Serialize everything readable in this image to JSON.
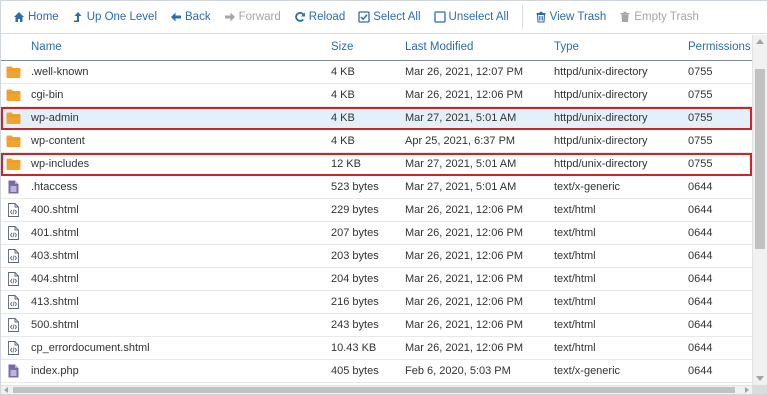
{
  "toolbar": {
    "home": "Home",
    "up_one_level": "Up One Level",
    "back": "Back",
    "forward": "Forward",
    "reload": "Reload",
    "select_all": "Select All",
    "unselect_all": "Unselect All",
    "view_trash": "View Trash",
    "empty_trash": "Empty Trash"
  },
  "columns": {
    "name": "Name",
    "size": "Size",
    "last_modified": "Last Modified",
    "type": "Type",
    "permissions": "Permissions"
  },
  "colors": {
    "link_blue": "#2a6db0",
    "folder": "#f0a430",
    "file_purple": "#7a6aa8",
    "highlight_red": "#c9262b",
    "selected_row": "#e4f0f9"
  },
  "files": [
    {
      "icon": "folder-icon",
      "name": ".well-known",
      "size": "4 KB",
      "modified": "Mar 26, 2021, 12:07 PM",
      "type": "httpd/unix-directory",
      "perms": "0755",
      "selected": false,
      "highlight": false
    },
    {
      "icon": "folder-icon",
      "name": "cgi-bin",
      "size": "4 KB",
      "modified": "Mar 26, 2021, 12:06 PM",
      "type": "httpd/unix-directory",
      "perms": "0755",
      "selected": false,
      "highlight": false
    },
    {
      "icon": "folder-icon",
      "name": "wp-admin",
      "size": "4 KB",
      "modified": "Mar 27, 2021, 5:01 AM",
      "type": "httpd/unix-directory",
      "perms": "0755",
      "selected": true,
      "highlight": true
    },
    {
      "icon": "folder-icon",
      "name": "wp-content",
      "size": "4 KB",
      "modified": "Apr 25, 2021, 6:37 PM",
      "type": "httpd/unix-directory",
      "perms": "0755",
      "selected": false,
      "highlight": false
    },
    {
      "icon": "folder-icon",
      "name": "wp-includes",
      "size": "12 KB",
      "modified": "Mar 27, 2021, 5:01 AM",
      "type": "httpd/unix-directory",
      "perms": "0755",
      "selected": false,
      "highlight": true
    },
    {
      "icon": "text-file-icon",
      "name": ".htaccess",
      "size": "523 bytes",
      "modified": "Mar 27, 2021, 5:01 AM",
      "type": "text/x-generic",
      "perms": "0644",
      "selected": false,
      "highlight": false
    },
    {
      "icon": "code-file-icon",
      "name": "400.shtml",
      "size": "229 bytes",
      "modified": "Mar 26, 2021, 12:06 PM",
      "type": "text/html",
      "perms": "0644",
      "selected": false,
      "highlight": false
    },
    {
      "icon": "code-file-icon",
      "name": "401.shtml",
      "size": "207 bytes",
      "modified": "Mar 26, 2021, 12:06 PM",
      "type": "text/html",
      "perms": "0644",
      "selected": false,
      "highlight": false
    },
    {
      "icon": "code-file-icon",
      "name": "403.shtml",
      "size": "203 bytes",
      "modified": "Mar 26, 2021, 12:06 PM",
      "type": "text/html",
      "perms": "0644",
      "selected": false,
      "highlight": false
    },
    {
      "icon": "code-file-icon",
      "name": "404.shtml",
      "size": "204 bytes",
      "modified": "Mar 26, 2021, 12:06 PM",
      "type": "text/html",
      "perms": "0644",
      "selected": false,
      "highlight": false
    },
    {
      "icon": "code-file-icon",
      "name": "413.shtml",
      "size": "216 bytes",
      "modified": "Mar 26, 2021, 12:06 PM",
      "type": "text/html",
      "perms": "0644",
      "selected": false,
      "highlight": false
    },
    {
      "icon": "code-file-icon",
      "name": "500.shtml",
      "size": "243 bytes",
      "modified": "Mar 26, 2021, 12:06 PM",
      "type": "text/html",
      "perms": "0644",
      "selected": false,
      "highlight": false
    },
    {
      "icon": "code-file-icon",
      "name": "cp_errordocument.shtml",
      "size": "10.43 KB",
      "modified": "Mar 26, 2021, 12:06 PM",
      "type": "text/html",
      "perms": "0644",
      "selected": false,
      "highlight": false
    },
    {
      "icon": "text-file-icon",
      "name": "index.php",
      "size": "405 bytes",
      "modified": "Feb 6, 2020, 5:03 PM",
      "type": "text/x-generic",
      "perms": "0644",
      "selected": false,
      "highlight": false
    }
  ]
}
